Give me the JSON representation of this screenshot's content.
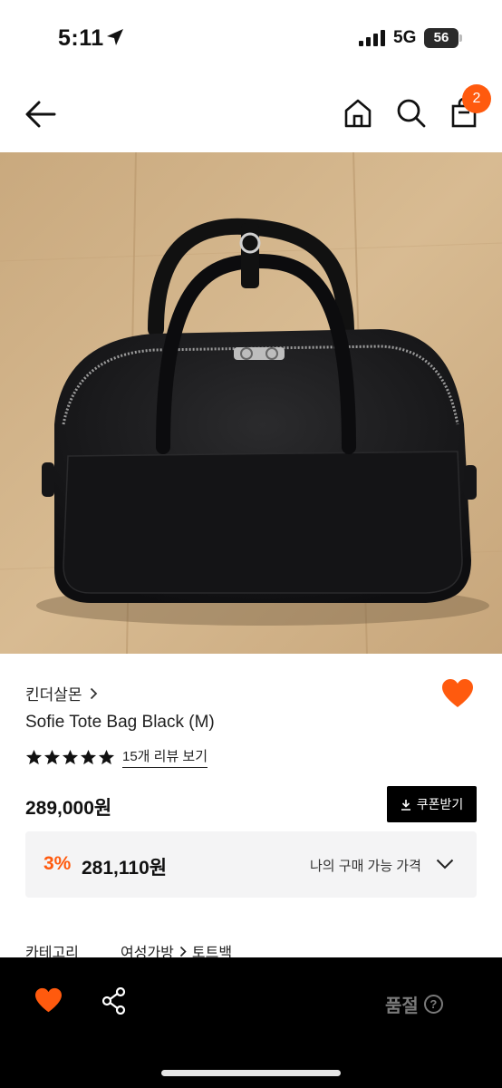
{
  "status_bar": {
    "time": "5:11",
    "network": "5G",
    "battery": "56"
  },
  "nav": {
    "cart_count": "2",
    "icons": [
      "back-arrow-icon",
      "home-icon",
      "search-icon",
      "shopping-bag-icon"
    ]
  },
  "product": {
    "brand": "킨더살몬",
    "title": "Sofie Tote Bag Black (M)",
    "rating_stars": 5,
    "review_link": "15개 리뷰 보기",
    "price": "289,000원",
    "coupon_label": "쿠폰받기",
    "discount": {
      "rate": "3%",
      "price": "281,110원",
      "my_price_label": "나의 구매 가능 가격"
    },
    "category": {
      "label": "카테고리",
      "level1": "여성가방",
      "level2": "토트백"
    }
  },
  "bottom_bar": {
    "soldout_label": "품절",
    "help_glyph": "?"
  },
  "colors": {
    "accent": "#ff5a0e",
    "bottom_bar": "#000000",
    "discount_bg": "#f4f4f5"
  }
}
